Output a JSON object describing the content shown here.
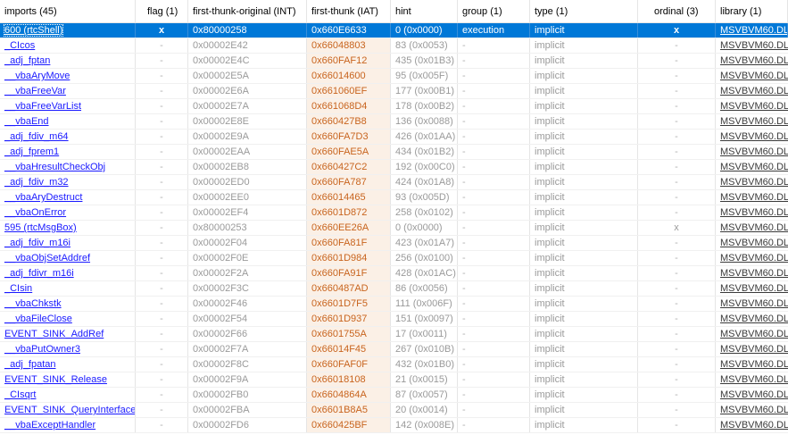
{
  "columns": [
    "imports (45)",
    "flag (1)",
    "first-thunk-original (INT)",
    "first-thunk (IAT)",
    "hint",
    "group (1)",
    "type (1)",
    "ordinal (3)",
    "library (1)"
  ],
  "rows": [
    {
      "name": "600 (rtcShell)",
      "flag": "x",
      "int": "0x80000258",
      "iat": "0x660E6633",
      "hint": "0 (0x0000)",
      "group": "execution",
      "type": "implicit",
      "ordinal": "x",
      "library": "MSVBVM60.DLL",
      "selected": true
    },
    {
      "name": "_CIcos",
      "flag": "-",
      "int": "0x00002E42",
      "iat": "0x66048803",
      "hint": "83 (0x0053)",
      "group": "-",
      "type": "implicit",
      "ordinal": "-",
      "library": "MSVBVM60.DLL"
    },
    {
      "name": "_adj_fptan",
      "flag": "-",
      "int": "0x00002E4C",
      "iat": "0x660FAF12",
      "hint": "435 (0x01B3)",
      "group": "-",
      "type": "implicit",
      "ordinal": "-",
      "library": "MSVBVM60.DLL"
    },
    {
      "name": "__vbaAryMove",
      "flag": "-",
      "int": "0x00002E5A",
      "iat": "0x66014600",
      "hint": "95 (0x005F)",
      "group": "-",
      "type": "implicit",
      "ordinal": "-",
      "library": "MSVBVM60.DLL"
    },
    {
      "name": "__vbaFreeVar",
      "flag": "-",
      "int": "0x00002E6A",
      "iat": "0x661060EF",
      "hint": "177 (0x00B1)",
      "group": "-",
      "type": "implicit",
      "ordinal": "-",
      "library": "MSVBVM60.DLL"
    },
    {
      "name": "__vbaFreeVarList",
      "flag": "-",
      "int": "0x00002E7A",
      "iat": "0x661068D4",
      "hint": "178 (0x00B2)",
      "group": "-",
      "type": "implicit",
      "ordinal": "-",
      "library": "MSVBVM60.DLL"
    },
    {
      "name": "__vbaEnd",
      "flag": "-",
      "int": "0x00002E8E",
      "iat": "0x660427B8",
      "hint": "136 (0x0088)",
      "group": "-",
      "type": "implicit",
      "ordinal": "-",
      "library": "MSVBVM60.DLL"
    },
    {
      "name": "_adj_fdiv_m64",
      "flag": "-",
      "int": "0x00002E9A",
      "iat": "0x660FA7D3",
      "hint": "426 (0x01AA)",
      "group": "-",
      "type": "implicit",
      "ordinal": "-",
      "library": "MSVBVM60.DLL"
    },
    {
      "name": "_adj_fprem1",
      "flag": "-",
      "int": "0x00002EAA",
      "iat": "0x660FAE5A",
      "hint": "434 (0x01B2)",
      "group": "-",
      "type": "implicit",
      "ordinal": "-",
      "library": "MSVBVM60.DLL"
    },
    {
      "name": "__vbaHresultCheckObj",
      "flag": "-",
      "int": "0x00002EB8",
      "iat": "0x660427C2",
      "hint": "192 (0x00C0)",
      "group": "-",
      "type": "implicit",
      "ordinal": "-",
      "library": "MSVBVM60.DLL"
    },
    {
      "name": "_adj_fdiv_m32",
      "flag": "-",
      "int": "0x00002ED0",
      "iat": "0x660FA787",
      "hint": "424 (0x01A8)",
      "group": "-",
      "type": "implicit",
      "ordinal": "-",
      "library": "MSVBVM60.DLL"
    },
    {
      "name": "__vbaAryDestruct",
      "flag": "-",
      "int": "0x00002EE0",
      "iat": "0x66014465",
      "hint": "93 (0x005D)",
      "group": "-",
      "type": "implicit",
      "ordinal": "-",
      "library": "MSVBVM60.DLL"
    },
    {
      "name": "__vbaOnError",
      "flag": "-",
      "int": "0x00002EF4",
      "iat": "0x6601D872",
      "hint": "258 (0x0102)",
      "group": "-",
      "type": "implicit",
      "ordinal": "-",
      "library": "MSVBVM60.DLL"
    },
    {
      "name": "595 (rtcMsgBox)",
      "flag": "-",
      "int": "0x80000253",
      "iat": "0x660EE26A",
      "hint": "0 (0x0000)",
      "group": "-",
      "type": "implicit",
      "ordinal": "x",
      "library": "MSVBVM60.DLL"
    },
    {
      "name": "_adj_fdiv_m16i",
      "flag": "-",
      "int": "0x00002F04",
      "iat": "0x660FA81F",
      "hint": "423 (0x01A7)",
      "group": "-",
      "type": "implicit",
      "ordinal": "-",
      "library": "MSVBVM60.DLL"
    },
    {
      "name": "__vbaObjSetAddref",
      "flag": "-",
      "int": "0x00002F0E",
      "iat": "0x6601D984",
      "hint": "256 (0x0100)",
      "group": "-",
      "type": "implicit",
      "ordinal": "-",
      "library": "MSVBVM60.DLL"
    },
    {
      "name": "_adj_fdivr_m16i",
      "flag": "-",
      "int": "0x00002F2A",
      "iat": "0x660FA91F",
      "hint": "428 (0x01AC)",
      "group": "-",
      "type": "implicit",
      "ordinal": "-",
      "library": "MSVBVM60.DLL"
    },
    {
      "name": "_CIsin",
      "flag": "-",
      "int": "0x00002F3C",
      "iat": "0x660487AD",
      "hint": "86 (0x0056)",
      "group": "-",
      "type": "implicit",
      "ordinal": "-",
      "library": "MSVBVM60.DLL"
    },
    {
      "name": "__vbaChkstk",
      "flag": "-",
      "int": "0x00002F46",
      "iat": "0x6601D7F5",
      "hint": "111 (0x006F)",
      "group": "-",
      "type": "implicit",
      "ordinal": "-",
      "library": "MSVBVM60.DLL"
    },
    {
      "name": "__vbaFileClose",
      "flag": "-",
      "int": "0x00002F54",
      "iat": "0x6601D937",
      "hint": "151 (0x0097)",
      "group": "-",
      "type": "implicit",
      "ordinal": "-",
      "library": "MSVBVM60.DLL"
    },
    {
      "name": "EVENT_SINK_AddRef",
      "flag": "-",
      "int": "0x00002F66",
      "iat": "0x6601755A",
      "hint": "17 (0x0011)",
      "group": "-",
      "type": "implicit",
      "ordinal": "-",
      "library": "MSVBVM60.DLL"
    },
    {
      "name": "__vbaPutOwner3",
      "flag": "-",
      "int": "0x00002F7A",
      "iat": "0x66014F45",
      "hint": "267 (0x010B)",
      "group": "-",
      "type": "implicit",
      "ordinal": "-",
      "library": "MSVBVM60.DLL"
    },
    {
      "name": "_adj_fpatan",
      "flag": "-",
      "int": "0x00002F8C",
      "iat": "0x660FAF0F",
      "hint": "432 (0x01B0)",
      "group": "-",
      "type": "implicit",
      "ordinal": "-",
      "library": "MSVBVM60.DLL"
    },
    {
      "name": "EVENT_SINK_Release",
      "flag": "-",
      "int": "0x00002F9A",
      "iat": "0x66018108",
      "hint": "21 (0x0015)",
      "group": "-",
      "type": "implicit",
      "ordinal": "-",
      "library": "MSVBVM60.DLL"
    },
    {
      "name": "_CIsqrt",
      "flag": "-",
      "int": "0x00002FB0",
      "iat": "0x6604864A",
      "hint": "87 (0x0057)",
      "group": "-",
      "type": "implicit",
      "ordinal": "-",
      "library": "MSVBVM60.DLL"
    },
    {
      "name": "EVENT_SINK_QueryInterface",
      "flag": "-",
      "int": "0x00002FBA",
      "iat": "0x6601B8A5",
      "hint": "20 (0x0014)",
      "group": "-",
      "type": "implicit",
      "ordinal": "-",
      "library": "MSVBVM60.DLL"
    },
    {
      "name": "__vbaExceptHandler",
      "flag": "-",
      "int": "0x00002FD6",
      "iat": "0x660425BF",
      "hint": "142 (0x008E)",
      "group": "-",
      "type": "implicit",
      "ordinal": "-",
      "library": "MSVBVM60.DLL"
    }
  ]
}
